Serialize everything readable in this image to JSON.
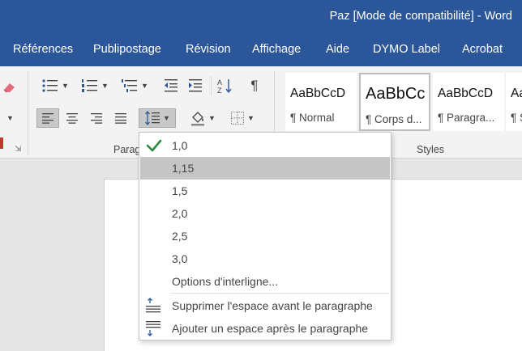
{
  "window": {
    "title": "Paz [Mode de compatibilité]  -  Word"
  },
  "tabs": [
    "Références",
    "Publipostage",
    "Révision",
    "Affichage",
    "Aide",
    "DYMO Label",
    "Acrobat"
  ],
  "ribbon": {
    "paragraph_group_label": "Parag",
    "styles_group_label": "Styles",
    "styles": [
      {
        "sample": "AaBbCcD",
        "name": "¶ Normal"
      },
      {
        "sample": "AaBbCc",
        "name": "¶ Corps d..."
      },
      {
        "sample": "AaBbCcD",
        "name": "¶ Paragra..."
      },
      {
        "sample": "Aa",
        "name": "¶ S"
      }
    ]
  },
  "line_spacing_menu": {
    "options": [
      "1,0",
      "1,15",
      "1,5",
      "2,0",
      "2,5",
      "3,0"
    ],
    "checked": "1,0",
    "hovered": "1,15",
    "more_options": "Options d'interligne...",
    "remove_space_before": "Supprimer l'espace avant le paragraphe",
    "add_space_after": "Ajouter un espace après le paragraphe"
  },
  "colors": {
    "title_bar": "#2b579a",
    "check": "#2e8b3e",
    "hover": "#c5c5c5",
    "accent_icon": "#2b579a"
  }
}
